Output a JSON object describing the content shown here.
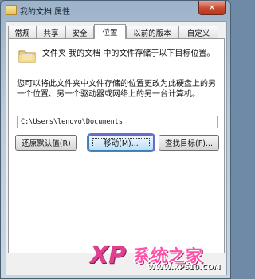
{
  "window": {
    "title": "我的文档 属性",
    "close_label": "✕"
  },
  "tabs": [
    {
      "label": "常规"
    },
    {
      "label": "共享"
    },
    {
      "label": "安全"
    },
    {
      "label": "位置",
      "active": true
    },
    {
      "label": "以前的版本"
    },
    {
      "label": "自定义"
    }
  ],
  "location": {
    "description_1": "文件夹 我的文档 中的文件存储于以下目标位置。",
    "description_2": "您可以将此文件夹中文件存储的位置更改为此硬盘上的另一个位置、另一个驱动器或网络上的另一台计算机。",
    "path_value": "C:\\Users\\lenovo\\Documents",
    "restore_label": "还原默认值(R)",
    "move_label": "移动(M)...",
    "find_target_label": "查找目标(F)..."
  },
  "watermark": {
    "logo": "XP",
    "title": "系统之家",
    "url": "WWW.XP510.COM"
  },
  "colors": {
    "move_focus_outline": "#6b6fce",
    "watermark_pink": "#ff4fa8",
    "watermark_blue": "#2a6fd1"
  }
}
